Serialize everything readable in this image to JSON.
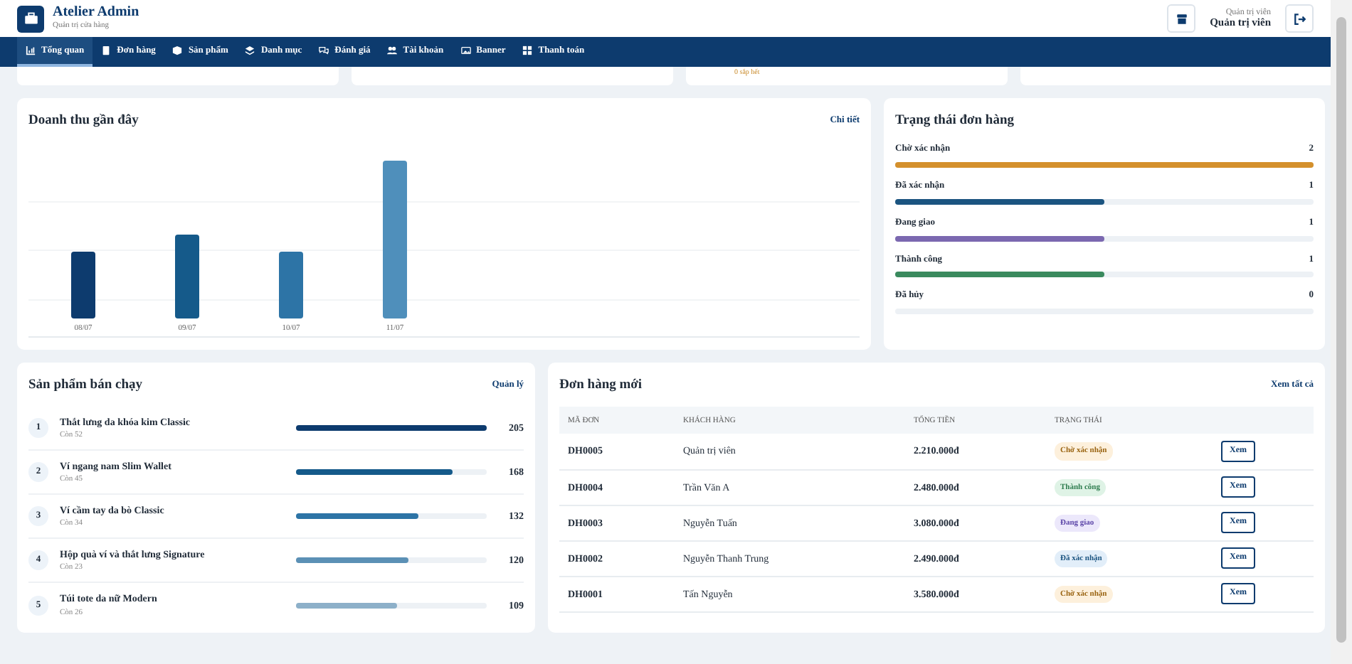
{
  "brand": {
    "title": "Atelier Admin",
    "subtitle": "Quản trị cửa hàng"
  },
  "user": {
    "role": "Quản trị viên",
    "name": "Quản trị viên"
  },
  "nav": [
    {
      "label": "Tổng quan",
      "selected": true
    },
    {
      "label": "Đơn hàng",
      "selected": false
    },
    {
      "label": "Sản phẩm",
      "selected": false
    },
    {
      "label": "Danh mục",
      "selected": false
    },
    {
      "label": "Đánh giá",
      "selected": false
    },
    {
      "label": "Tài khoản",
      "selected": false
    },
    {
      "label": "Banner",
      "selected": false
    },
    {
      "label": "Thanh toán",
      "selected": false
    }
  ],
  "stock_note": "0 sắp hết",
  "revenue": {
    "title": "Doanh thu gần đây",
    "link": "Chi tiết",
    "labels": [
      "08/07",
      "09/07",
      "10/07",
      "11/07"
    ]
  },
  "order_status": {
    "title": "Trạng thái đơn hàng",
    "items": [
      {
        "label": "Chờ xác nhận",
        "count": "2",
        "level": 1,
        "color": "#d4902c"
      },
      {
        "label": "Đã xác nhận",
        "count": "1",
        "level": 0.5,
        "color": "#1b5480"
      },
      {
        "label": "Đang giao",
        "count": "1",
        "level": 0.5,
        "color": "#7b68b0"
      },
      {
        "label": "Thành công",
        "count": "1",
        "level": 0.5,
        "color": "#3a8a5e"
      },
      {
        "label": "Đã hủy",
        "count": "0",
        "level": 0
      }
    ]
  },
  "best_sellers": {
    "title": "Sản phẩm bán chạy",
    "link": "Quản lý",
    "items": [
      {
        "rank": "1",
        "name": "Thắt lưng da khóa kim Classic",
        "stock": "Còn 52",
        "sold": "205",
        "level": 1,
        "color": "#0d3b6e"
      },
      {
        "rank": "2",
        "name": "Ví ngang nam Slim Wallet",
        "stock": "Còn 45",
        "sold": "168",
        "level": 0.82,
        "color": "#155a8a"
      },
      {
        "rank": "3",
        "name": "Ví cầm tay da bò Classic",
        "stock": "Còn 34",
        "sold": "132",
        "level": 0.64,
        "color": "#2d74a6"
      },
      {
        "rank": "4",
        "name": "Hộp quà ví và thắt lưng Signature",
        "stock": "Còn 23",
        "sold": "120",
        "level": 0.59,
        "color": "#5b90b5"
      },
      {
        "rank": "5",
        "name": "Túi tote da nữ Modern",
        "stock": "Còn 26",
        "sold": "109",
        "level": 0.53,
        "color": "#8db0c9"
      }
    ]
  },
  "new_orders": {
    "title": "Đơn hàng mới",
    "link": "Xem tất cả",
    "columns": [
      "MÃ ĐƠN",
      "KHÁCH HÀNG",
      "TỔNG TIỀN",
      "TRẠNG THÁI"
    ],
    "rows": [
      {
        "id": "DH0005",
        "customer": "Quản trị viên",
        "total": "2.210.000đ",
        "status": "Chờ xác nhận",
        "kind": "pending",
        "action": "Xem"
      },
      {
        "id": "DH0004",
        "customer": "Trần Văn A",
        "total": "2.480.000đ",
        "status": "Thành công",
        "kind": "done",
        "action": "Xem"
      },
      {
        "id": "DH0003",
        "customer": "Nguyễn Tuấn",
        "total": "3.080.000đ",
        "status": "Đang giao",
        "kind": "shipping",
        "action": "Xem"
      },
      {
        "id": "DH0002",
        "customer": "Nguyễn Thanh Trung",
        "total": "2.490.000đ",
        "status": "Đã xác nhận",
        "kind": "confirmed",
        "action": "Xem"
      },
      {
        "id": "DH0001",
        "customer": "Tấn Nguyễn",
        "total": "3.580.000đ",
        "status": "Chờ xác nhận",
        "kind": "pending",
        "action": "Xem"
      }
    ]
  }
}
